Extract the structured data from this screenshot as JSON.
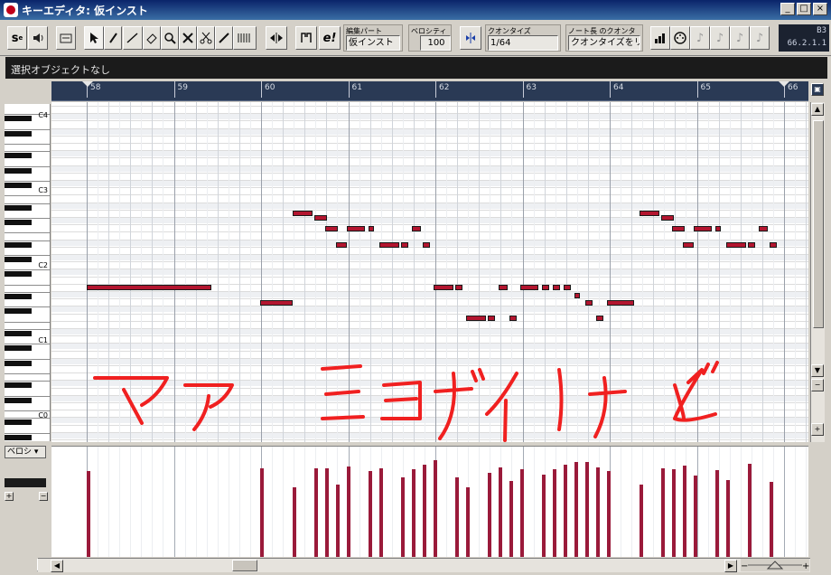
{
  "window": {
    "title": "キーエディタ: 仮インスト"
  },
  "window_buttons": {
    "minimize": "_",
    "maximize": "□",
    "close": "×"
  },
  "toolbar": {
    "edit_part_label": "編集パート",
    "edit_part_value": "仮インスト",
    "velocity_label": "ベロシティ",
    "velocity_value": "100",
    "quantize_label": "クオンタイズ",
    "quantize_value": "1/64",
    "note_length_label": "ノート長 のクオンタイズ",
    "note_length_value": "クオンタイズをリ",
    "position_bar": "B3",
    "position_time": "66.2.1.1",
    "edit_e_label": "e!"
  },
  "status": {
    "text": "選択オブジェクトなし"
  },
  "ruler": {
    "bars": [
      "58",
      "59",
      "60",
      "61",
      "62",
      "63",
      "64",
      "65",
      "66"
    ]
  },
  "keyboard": {
    "octave_labels": [
      "C4",
      "C3",
      "C2",
      "C1",
      "C0"
    ]
  },
  "controller": {
    "lane_label": "ベロシ"
  },
  "handwriting": {
    "text": "マア ショボイけど"
  },
  "colors": {
    "note": "#b3152f",
    "velocity": "#9a1a3a",
    "ruler": "#2a3a55"
  }
}
